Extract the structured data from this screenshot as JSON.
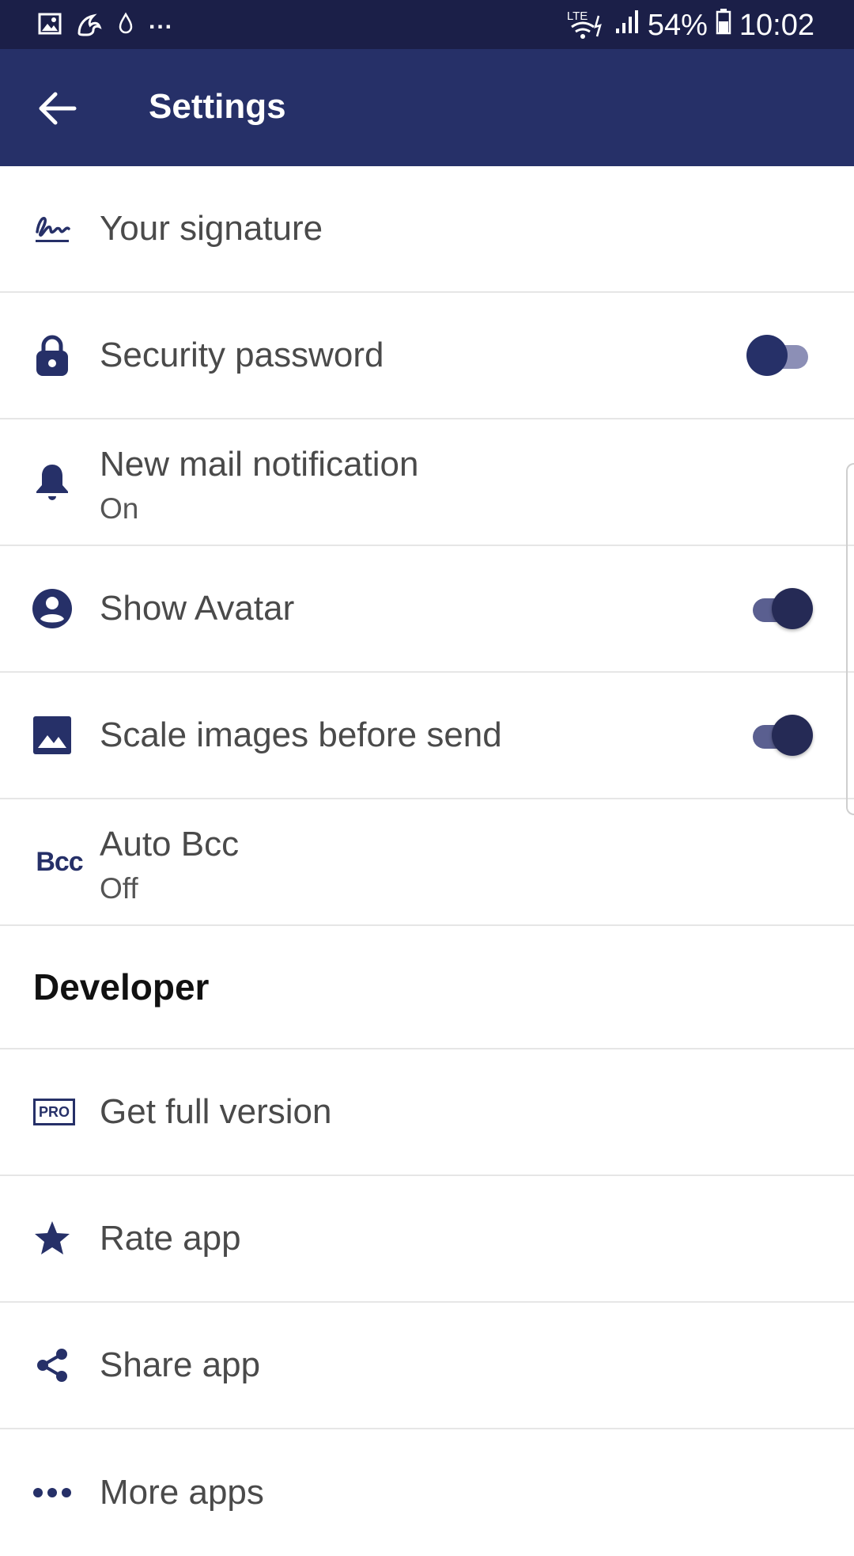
{
  "status_bar": {
    "network": "LTE",
    "battery": "54%",
    "time": "10:02",
    "more": "..."
  },
  "app_bar": {
    "title": "Settings"
  },
  "settings": {
    "signature": {
      "label": "Your signature",
      "icon": "signature-icon"
    },
    "security_password": {
      "label": "Security password",
      "icon": "lock-icon",
      "enabled": false
    },
    "new_mail_notification": {
      "label": "New mail notification",
      "value": "On",
      "icon": "bell-icon"
    },
    "show_avatar": {
      "label": "Show Avatar",
      "icon": "avatar-icon",
      "enabled": true
    },
    "scale_images": {
      "label": "Scale images before send",
      "icon": "image-icon",
      "enabled": true
    },
    "auto_bcc": {
      "label": "Auto Bcc",
      "value": "Off",
      "icon_text": "Bcc"
    }
  },
  "developer": {
    "header": "Developer",
    "get_full_version": {
      "label": "Get full version",
      "icon_text": "PRO"
    },
    "rate_app": {
      "label": "Rate app",
      "icon": "star-icon"
    },
    "share_app": {
      "label": "Share app",
      "icon": "share-icon"
    },
    "more_apps": {
      "label": "More apps",
      "icon": "more-dots-icon"
    }
  },
  "colors": {
    "status_bar": "#1b1f48",
    "app_bar": "#263068",
    "accent": "#263068",
    "text": "#4a4a4a"
  }
}
